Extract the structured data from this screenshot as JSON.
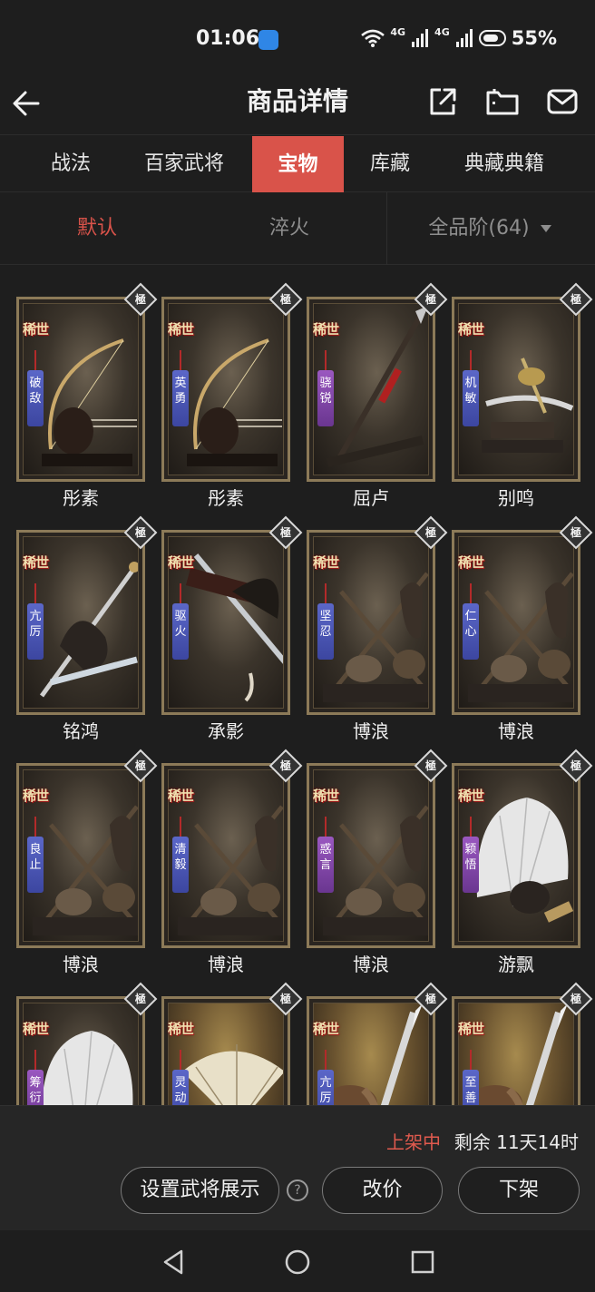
{
  "status_bar": {
    "time": "01:06",
    "network_label_1": "4G",
    "network_label_2": "4G",
    "battery": "55%"
  },
  "header": {
    "title": "商品详情",
    "back_icon": "arrow-left-icon",
    "share_icon": "share-icon",
    "folder_icon": "folder-icon",
    "mail_icon": "mail-icon"
  },
  "tabs": [
    {
      "label": "战法",
      "active": false
    },
    {
      "label": "百家武将",
      "active": false
    },
    {
      "label": "宝物",
      "active": true
    },
    {
      "label": "库藏",
      "active": false
    },
    {
      "label": "典藏典籍",
      "active": false
    }
  ],
  "filters": {
    "default": "默认",
    "temper": "淬火",
    "grade": "全品阶(64)"
  },
  "card_badge": "極",
  "card_rarity": "稀世",
  "items": [
    {
      "name": "彤素",
      "tag": "破敌",
      "tag_color": "blue",
      "art": "bow"
    },
    {
      "name": "彤素",
      "tag": "英勇",
      "tag_color": "blue",
      "art": "bow"
    },
    {
      "name": "屈卢",
      "tag": "骁锐",
      "tag_color": "purple",
      "art": "spear"
    },
    {
      "name": "别鸣",
      "tag": "机敏",
      "tag_color": "blue",
      "art": "sabre"
    },
    {
      "name": "铭鸿",
      "tag": "亢厉",
      "tag_color": "blue",
      "art": "sword"
    },
    {
      "name": "承影",
      "tag": "驱火",
      "tag_color": "blue",
      "art": "sword2"
    },
    {
      "name": "博浪",
      "tag": "坚忍",
      "tag_color": "blue",
      "art": "mace"
    },
    {
      "name": "博浪",
      "tag": "仁心",
      "tag_color": "blue",
      "art": "mace"
    },
    {
      "name": "博浪",
      "tag": "良止",
      "tag_color": "blue",
      "art": "mace"
    },
    {
      "name": "博浪",
      "tag": "清毅",
      "tag_color": "blue",
      "art": "mace"
    },
    {
      "name": "博浪",
      "tag": "惑言",
      "tag_color": "purple",
      "art": "mace"
    },
    {
      "name": "游飘",
      "tag": "颖悟",
      "tag_color": "purple",
      "art": "fan"
    },
    {
      "name": "",
      "tag": "筹衍",
      "tag_color": "purple",
      "art": "fan"
    },
    {
      "name": "",
      "tag": "灵动",
      "tag_color": "blue",
      "art": "fan2"
    },
    {
      "name": "",
      "tag": "亢厉",
      "tag_color": "blue",
      "art": "blade"
    },
    {
      "name": "",
      "tag": "至善",
      "tag_color": "blue",
      "art": "blade"
    }
  ],
  "bottom": {
    "status": "上架中",
    "remaining": "剩余 11天14时",
    "display_btn": "设置武将展示",
    "help_icon": "question-icon",
    "reprice_btn": "改价",
    "delist_btn": "下架"
  },
  "nav": {
    "back": "nav-back-icon",
    "home": "nav-home-icon",
    "recents": "nav-recents-icon"
  },
  "colors": {
    "accent": "#d9534a",
    "background": "#1e1e1e",
    "frame": "#8c7a58",
    "tag_blue": "#4a56b8",
    "tag_purple": "#8446ad"
  }
}
